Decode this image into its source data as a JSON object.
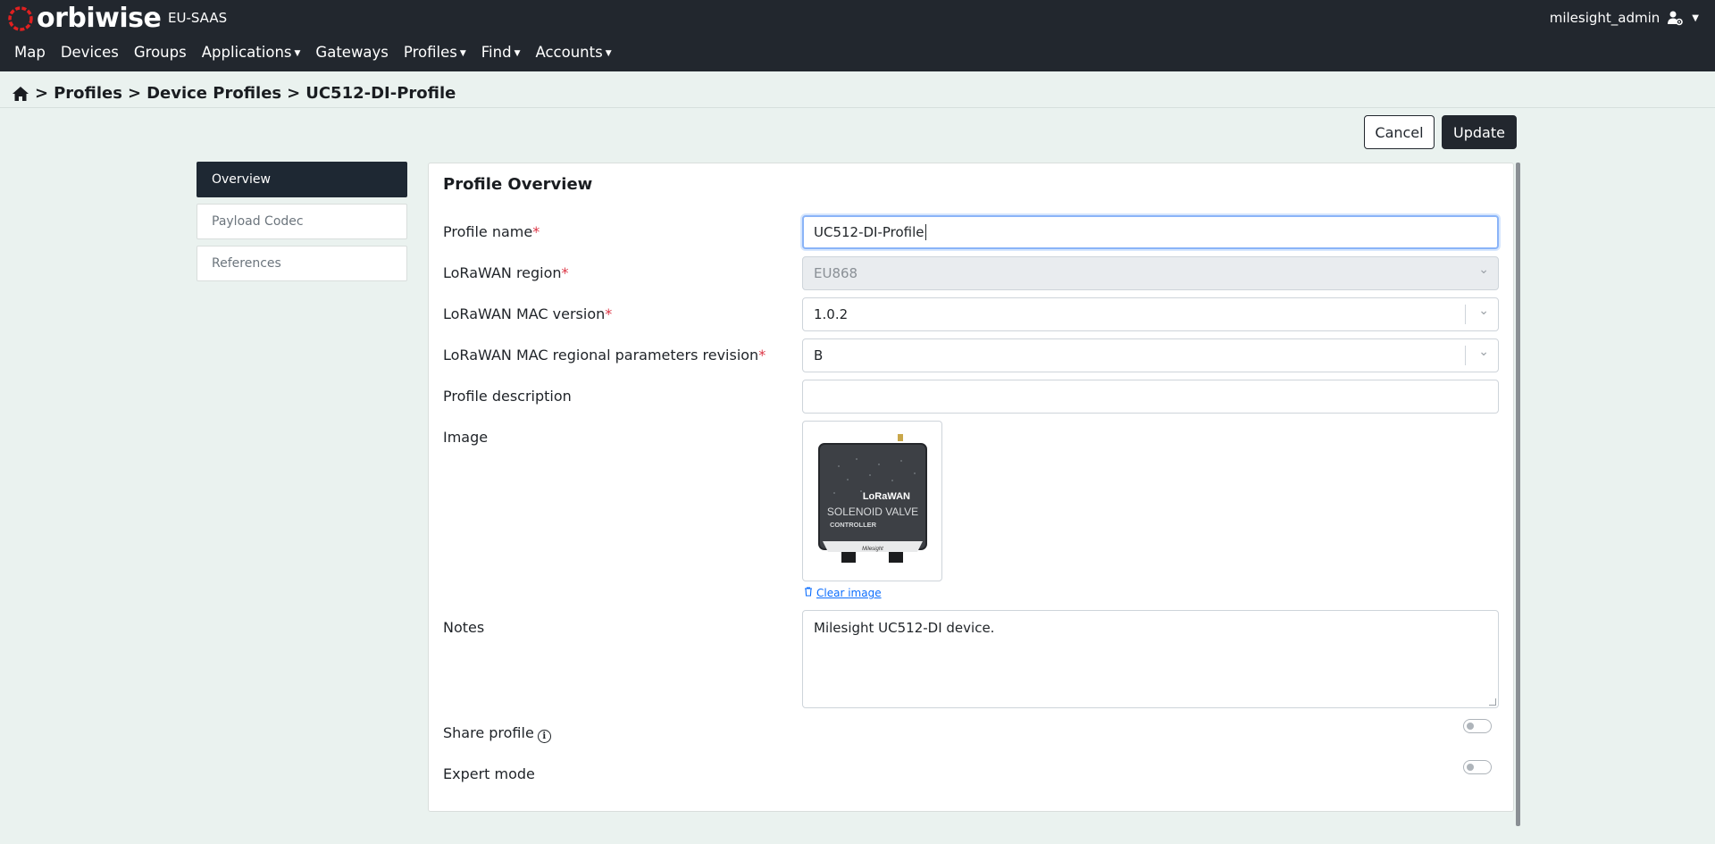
{
  "brand": {
    "name": "orbiwise",
    "tenant": "EU-SAAS",
    "accent_color": "#e02020"
  },
  "user": {
    "name": "milesight_admin",
    "icon": "user-gear-icon"
  },
  "nav": [
    {
      "label": "Map",
      "dropdown": false
    },
    {
      "label": "Devices",
      "dropdown": false
    },
    {
      "label": "Groups",
      "dropdown": false
    },
    {
      "label": "Applications",
      "dropdown": true
    },
    {
      "label": "Gateways",
      "dropdown": false
    },
    {
      "label": "Profiles",
      "dropdown": true
    },
    {
      "label": "Find",
      "dropdown": true
    },
    {
      "label": "Accounts",
      "dropdown": true
    }
  ],
  "breadcrumb": {
    "home_icon": "home-icon",
    "items": [
      "Profiles",
      "Device Profiles",
      "UC512-DI-Profile"
    ],
    "separator": ">"
  },
  "actions": {
    "cancel": "Cancel",
    "update": "Update"
  },
  "tabs": [
    {
      "label": "Overview",
      "active": true
    },
    {
      "label": "Payload Codec",
      "active": false
    },
    {
      "label": "References",
      "active": false
    }
  ],
  "panel": {
    "title": "Profile Overview",
    "profile_name": {
      "label": "Profile name",
      "required": "*",
      "value": "UC512-DI-Profile"
    },
    "region": {
      "label": "LoRaWAN region",
      "required": "*",
      "value": "EU868",
      "disabled": true
    },
    "mac_version": {
      "label": "LoRaWAN MAC version",
      "required": "*",
      "value": "1.0.2"
    },
    "regional_revision": {
      "label": "LoRaWAN MAC regional parameters revision",
      "required": "*",
      "value": "B"
    },
    "description": {
      "label": "Profile description",
      "value": ""
    },
    "image": {
      "label": "Image",
      "clear_label": "Clear image",
      "device_text": {
        "brand": "LoRaWAN",
        "line1": "SOLENOID VALVE",
        "line2": "CONTROLLER",
        "maker": "Milesight"
      }
    },
    "notes": {
      "label": "Notes",
      "value": "Milesight UC512-DI device."
    },
    "share_profile": {
      "label": "Share profile",
      "info": "i",
      "on": false
    },
    "expert_mode": {
      "label": "Expert mode",
      "on": false
    }
  }
}
